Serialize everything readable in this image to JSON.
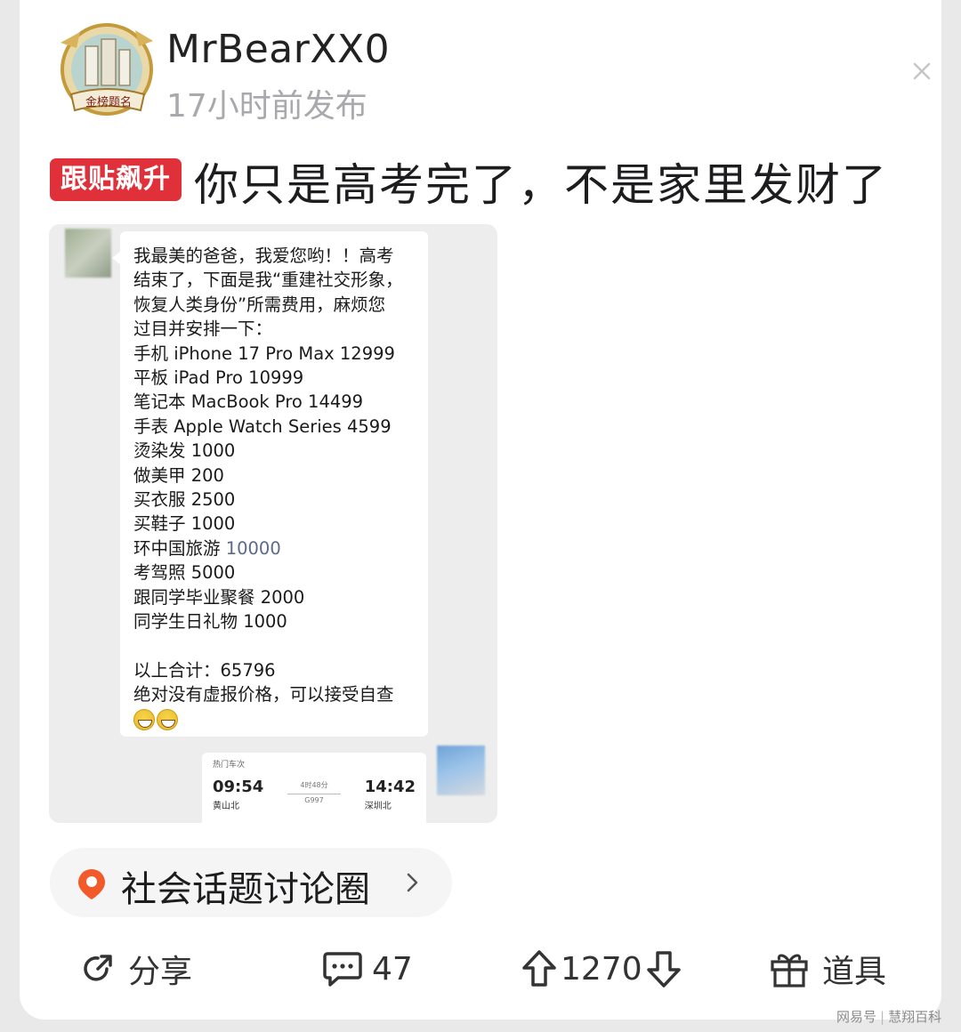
{
  "post": {
    "username": "MrBearXX0",
    "time": "17小时前发布",
    "avatar_seal_text": "金榜题名",
    "badge": "跟贴飙升",
    "title": "你只是高考完了，不是家里发财了"
  },
  "embed": {
    "message_lines": [
      "我最美的爸爸，我爱您哟！！高考",
      "结束了，下面是我“重建社交形象，",
      "恢复人类身份”所需费用，麻烦您",
      "过目并安排一下：",
      "手机 iPhone 17 Pro Max 12999",
      "平板 iPad Pro 10999",
      "笔记本 MacBook Pro 14499",
      "手表 Apple Watch Series 4599",
      "烫染发 1000",
      "做美甲 200",
      "买衣服 2500",
      "买鞋子 1000",
      "环中国旅游 ",
      "考驾照 5000",
      "跟同学毕业聚餐 2000",
      "同学生日礼物 1000",
      "",
      "以上合计：65796",
      "绝对没有虚报价格，可以接受自查"
    ],
    "travel_amount": "10000",
    "ticket": {
      "header": "热门车次",
      "depart_time": "09:54",
      "depart_station": "黄山北",
      "duration": "4时48分",
      "train_no": "G997",
      "arrive_time": "14:42",
      "arrive_station": "深圳北"
    }
  },
  "community": {
    "label": "社会话题讨论圈"
  },
  "actions": {
    "share_label": "分享",
    "comment_count": "47",
    "vote_count": "1270",
    "props_label": "道具"
  },
  "watermark": {
    "left": "网易号",
    "right": "慧翔百科"
  },
  "colors": {
    "badge_red": "#e0303a",
    "community_orange": "#f25a2a",
    "secondary_text": "#a9a9ad"
  }
}
